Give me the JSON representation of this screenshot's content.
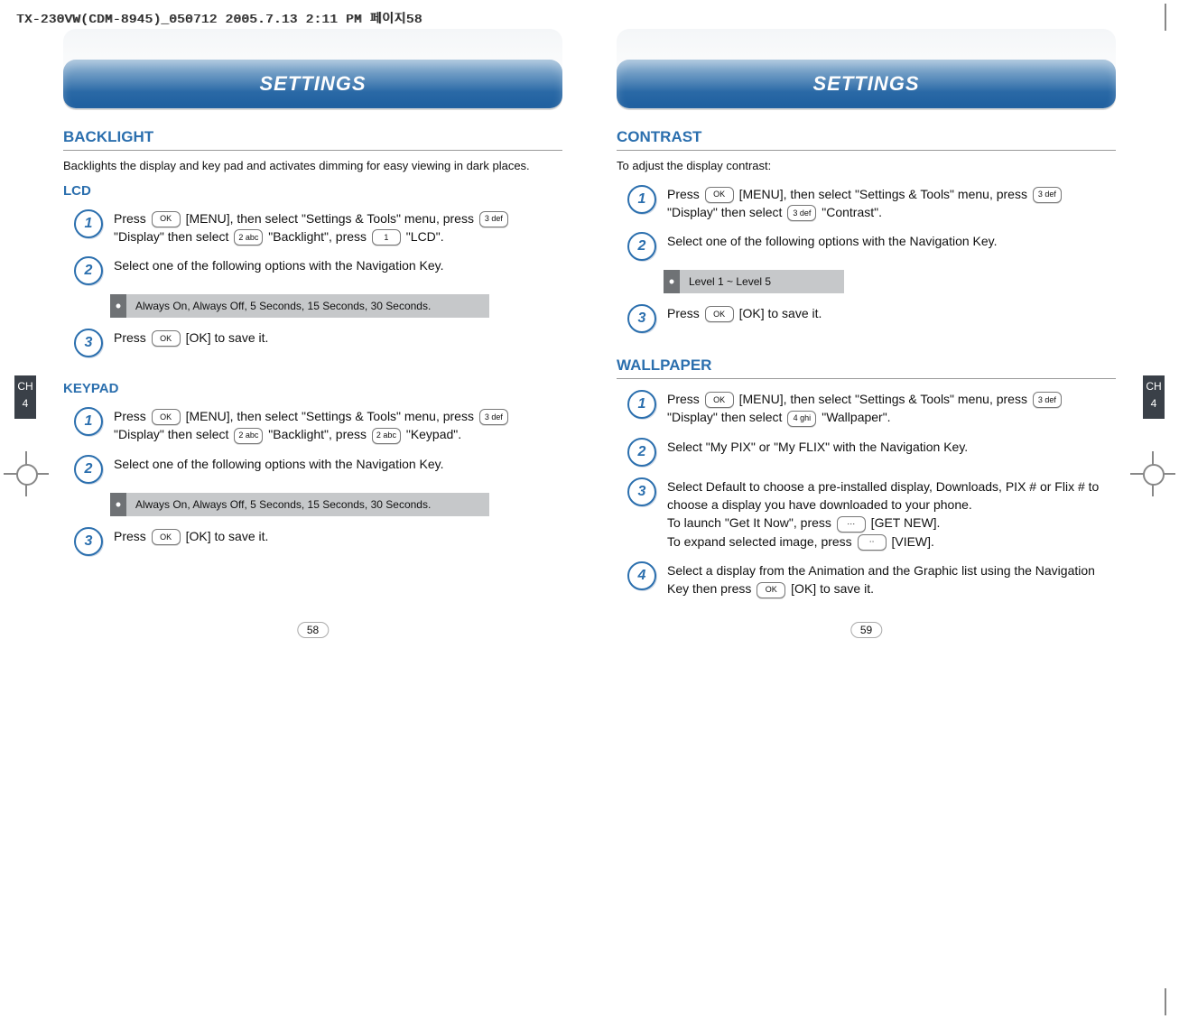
{
  "print_header": "TX-230VW(CDM-8945)_050712  2005.7.13 2:11 PM  페이지58",
  "chapter": {
    "label": "CH",
    "num": "4"
  },
  "left": {
    "banner": "SETTINGS",
    "page_num": "58",
    "backlight_title": "BACKLIGHT",
    "backlight_intro": "Backlights the display and key pad and activates dimming for easy viewing in dark places.",
    "lcd_title": "LCD",
    "lcd_step1_a": "Press ",
    "lcd_step1_b": " [MENU], then select \"Settings & Tools\" menu, press ",
    "lcd_step1_c": " \"Display\" then select ",
    "lcd_step1_d": " \"Backlight\", press ",
    "lcd_step1_e": " \"LCD\".",
    "lcd_step2": "Select one of the following options with the Navigation Key.",
    "lcd_note": "Always On, Always Off, 5 Seconds, 15 Seconds, 30 Seconds.",
    "lcd_step3_a": "Press ",
    "lcd_step3_b": " [OK] to save it.",
    "keypad_title": "KEYPAD",
    "key_step1_a": "Press ",
    "key_step1_b": " [MENU], then select \"Settings & Tools\" menu, press ",
    "key_step1_c": " \"Display\" then select ",
    "key_step1_d": " \"Backlight\", press ",
    "key_step1_e": " \"Keypad\".",
    "key_step2": "Select one of the following options with the Navigation Key.",
    "key_note": "Always On, Always Off, 5 Seconds, 15 Seconds, 30 Seconds.",
    "key_step3_a": "Press ",
    "key_step3_b": " [OK] to save it."
  },
  "right": {
    "banner": "SETTINGS",
    "page_num": "59",
    "contrast_title": "CONTRAST",
    "contrast_intro": "To adjust the display contrast:",
    "con_step1_a": "Press ",
    "con_step1_b": " [MENU], then select \"Settings & Tools\" menu, press ",
    "con_step1_c": " \"Display\" then select ",
    "con_step1_d": " \"Contrast\".",
    "con_step2": "Select one of the following options with the Navigation Key.",
    "con_note": "Level 1 ~ Level 5",
    "con_step3_a": "Press ",
    "con_step3_b": " [OK] to save it.",
    "wallpaper_title": "WALLPAPER",
    "wall_step1_a": "Press ",
    "wall_step1_b": " [MENU], then select \"Settings & Tools\" menu, press ",
    "wall_step1_c": " \"Display\" then select ",
    "wall_step1_d": " \"Wallpaper\".",
    "wall_step2": "Select \"My PIX\" or \"My FLIX\" with the Navigation Key.",
    "wall_step3_a": "Select Default to choose a pre-installed display, Downloads, PIX # or Flix # to choose a display you have downloaded to your phone.",
    "wall_step3_b": "To launch \"Get It Now\", press ",
    "wall_step3_c": " [GET NEW].",
    "wall_step3_d": "To expand selected image, press ",
    "wall_step3_e": " [VIEW].",
    "wall_step4_a": "Select a display from the Animation and the Graphic list using the Navigation Key then press ",
    "wall_step4_b": " [OK] to save it."
  },
  "keys": {
    "ok": "OK",
    "k1": "1",
    "k2": "2 abc",
    "k3": "3 def",
    "k4": "4 ghi",
    "soft_r": "⋯",
    "soft_l": "⋅⋅"
  },
  "nums": {
    "n1": "1",
    "n2": "2",
    "n3": "3",
    "n4": "4"
  }
}
